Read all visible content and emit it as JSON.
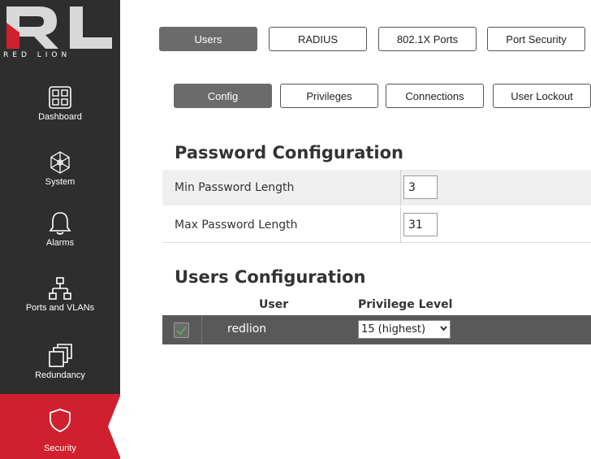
{
  "brand": {
    "name": "RED LION"
  },
  "sidebar": {
    "items": [
      {
        "label": "Dashboard",
        "icon": "dashboard-icon"
      },
      {
        "label": "System",
        "icon": "system-icon"
      },
      {
        "label": "Alarms",
        "icon": "bell-icon"
      },
      {
        "label": "Ports and VLANs",
        "icon": "network-icon"
      },
      {
        "label": "Redundancy",
        "icon": "redundancy-icon"
      },
      {
        "label": "Security",
        "icon": "shield-icon",
        "active": true
      }
    ]
  },
  "tabs": [
    {
      "label": "Users",
      "active": true
    },
    {
      "label": "RADIUS"
    },
    {
      "label": "802.1X Ports"
    },
    {
      "label": "Port Security"
    }
  ],
  "subtabs": [
    {
      "label": "Config",
      "active": true
    },
    {
      "label": "Privileges"
    },
    {
      "label": "Connections"
    },
    {
      "label": "User Lockout"
    }
  ],
  "password": {
    "title": "Password Configuration",
    "min_label": "Min Password Length",
    "min_value": "3",
    "max_label": "Max Password Length",
    "max_value": "31"
  },
  "users": {
    "title": "Users Configuration",
    "col_user": "User",
    "col_privilege": "Privilege Level",
    "rows": [
      {
        "user": "redlion",
        "privilege": "15 (highest)",
        "checked": true
      }
    ]
  },
  "colors": {
    "accent": "#d0202f",
    "sidebar": "#2e2e2e",
    "active_tab": "#6b6b6b",
    "row_dark": "#595959"
  }
}
